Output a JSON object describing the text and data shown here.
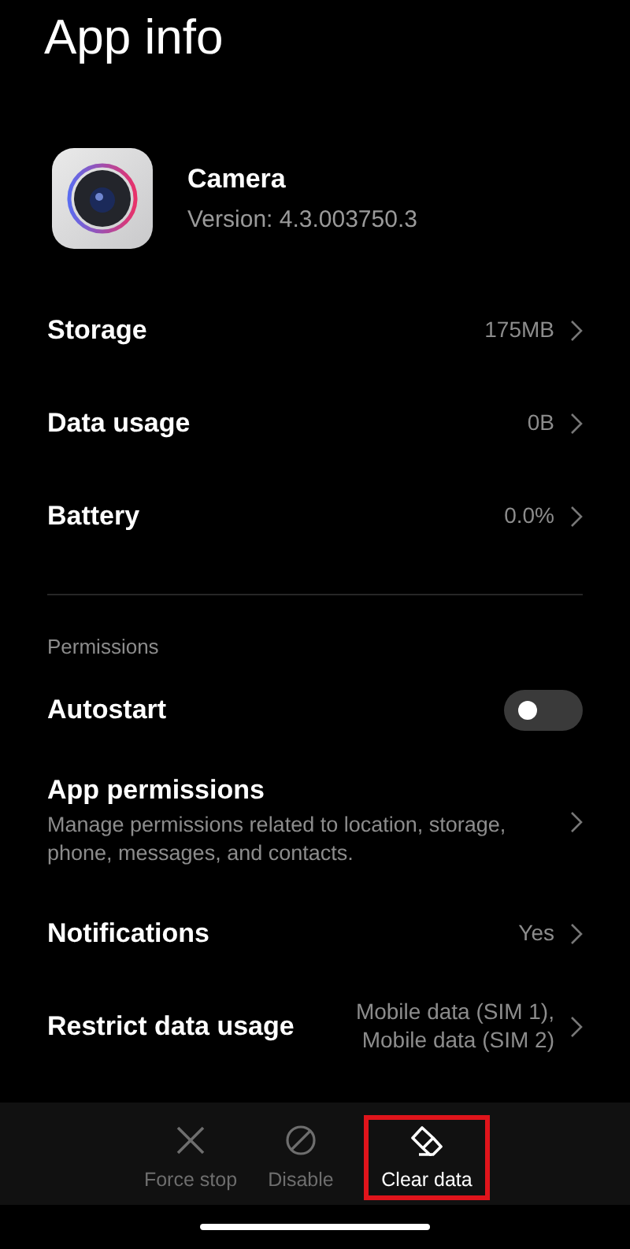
{
  "title": "App info",
  "app": {
    "name": "Camera",
    "version": "Version: 4.3.003750.3"
  },
  "sections": [
    {
      "items": [
        {
          "kind": "nav",
          "label": "Storage",
          "value": "175MB"
        },
        {
          "kind": "nav",
          "label": "Data usage",
          "value": "0B"
        },
        {
          "kind": "nav",
          "label": "Battery",
          "value": "0.0%"
        }
      ]
    },
    {
      "header": "Permissions",
      "items": [
        {
          "kind": "toggle",
          "label": "Autostart",
          "on": false
        },
        {
          "kind": "nav",
          "label": "App permissions",
          "description": "Manage permissions related to location, storage, phone, messages, and contacts."
        },
        {
          "kind": "nav",
          "label": "Notifications",
          "value": "Yes"
        },
        {
          "kind": "nav",
          "label": "Restrict data usage",
          "value": "Mobile data (SIM 1),\nMobile data (SIM 2)"
        }
      ]
    }
  ],
  "actions": [
    {
      "kind": "close",
      "label": "Force stop",
      "disabled": true,
      "highlighted": false
    },
    {
      "kind": "block",
      "label": "Disable",
      "disabled": true,
      "highlighted": false
    },
    {
      "kind": "eraser",
      "label": "Clear data",
      "disabled": false,
      "highlighted": true
    }
  ]
}
